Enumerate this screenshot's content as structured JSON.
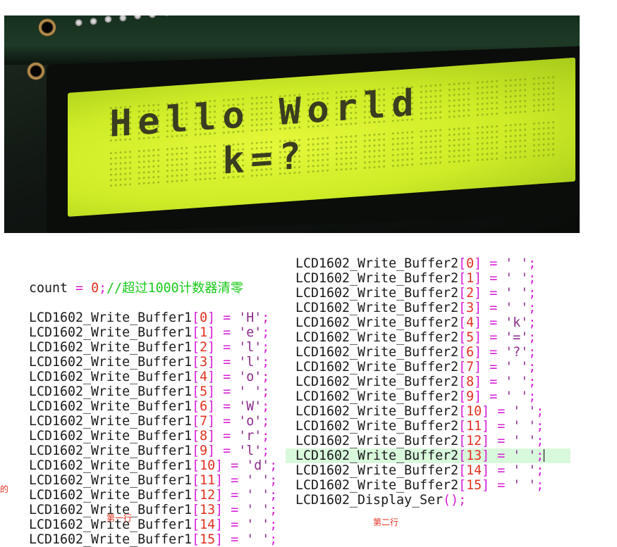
{
  "lcd": {
    "row1": [
      "H",
      "e",
      "l",
      "l",
      "o",
      " ",
      "W",
      "o",
      "r",
      "l",
      "d",
      " ",
      " ",
      " ",
      " ",
      " "
    ],
    "row2": [
      " ",
      " ",
      " ",
      " ",
      "k",
      "=",
      "?",
      " ",
      " ",
      " ",
      " ",
      " ",
      " ",
      " ",
      " ",
      " "
    ],
    "colors": {
      "backlight": "#d6ef2a",
      "pixel_on": "#3a3d20",
      "bezel": "#0b0d0b"
    }
  },
  "left_code": {
    "header": {
      "count_label": "count",
      "assign": " = ",
      "zero": "0",
      "semi": ";",
      "comment": "//超过1000计数器清零"
    },
    "prefix": "LCD1602_Write_Buffer1",
    "lines": [
      {
        "idx": "0",
        "val": "'H'"
      },
      {
        "idx": "1",
        "val": "'e'"
      },
      {
        "idx": "2",
        "val": "'l'"
      },
      {
        "idx": "3",
        "val": "'l'"
      },
      {
        "idx": "4",
        "val": "'o'"
      },
      {
        "idx": "5",
        "val": "' '"
      },
      {
        "idx": "6",
        "val": "'W'"
      },
      {
        "idx": "7",
        "val": "'o'"
      },
      {
        "idx": "8",
        "val": "'r'"
      },
      {
        "idx": "9",
        "val": "'l'"
      },
      {
        "idx": "10",
        "val": "'d'"
      },
      {
        "idx": "11",
        "val": "' '"
      },
      {
        "idx": "12",
        "val": "' '"
      },
      {
        "idx": "13",
        "val": "' '"
      },
      {
        "idx": "14",
        "val": "' '"
      },
      {
        "idx": "15",
        "val": "' '"
      }
    ],
    "caption": "第一行"
  },
  "right_code": {
    "prefix": "LCD1602_Write_Buffer2",
    "lines": [
      {
        "idx": "0",
        "val": "' '"
      },
      {
        "idx": "1",
        "val": "' '"
      },
      {
        "idx": "2",
        "val": "' '"
      },
      {
        "idx": "3",
        "val": "' '"
      },
      {
        "idx": "4",
        "val": "'k'"
      },
      {
        "idx": "5",
        "val": "'='"
      },
      {
        "idx": "6",
        "val": "'?'"
      },
      {
        "idx": "7",
        "val": "' '"
      },
      {
        "idx": "8",
        "val": "' '"
      },
      {
        "idx": "9",
        "val": "' '"
      },
      {
        "idx": "10",
        "val": "' '"
      },
      {
        "idx": "11",
        "val": "' '"
      },
      {
        "idx": "12",
        "val": "' '"
      },
      {
        "idx": "13",
        "val": "' '"
      },
      {
        "idx": "14",
        "val": "' '"
      },
      {
        "idx": "15",
        "val": "' '"
      }
    ],
    "highlighted_index": "13",
    "footer_call": "LCD1602_Display_Ser",
    "footer_parens": "()",
    "footer_semi": ";",
    "caption": "第二行"
  },
  "side_fragment": "的"
}
